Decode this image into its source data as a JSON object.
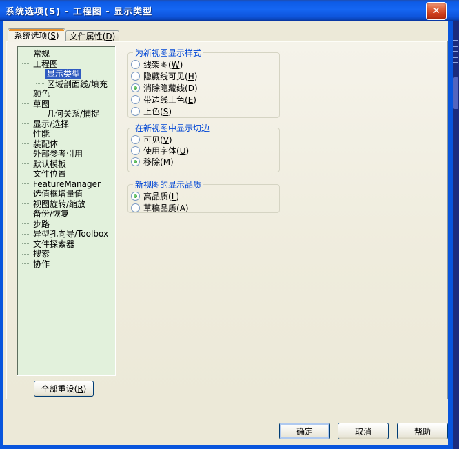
{
  "window": {
    "title": "系统选项(S) - 工程图 - 显示类型",
    "close_glyph": "✕"
  },
  "tabs": {
    "system_options": "系统选项(S)",
    "document_properties": "文件属性(D)"
  },
  "tree": {
    "items": [
      {
        "label": "常规",
        "level": 0
      },
      {
        "label": "工程图",
        "level": 0
      },
      {
        "label": "显示类型",
        "level": 1,
        "selected": true
      },
      {
        "label": "区域剖面线/填充",
        "level": 1
      },
      {
        "label": "颜色",
        "level": 0
      },
      {
        "label": "草图",
        "level": 0
      },
      {
        "label": "几何关系/捕捉",
        "level": 1
      },
      {
        "label": "显示/选择",
        "level": 0
      },
      {
        "label": "性能",
        "level": 0
      },
      {
        "label": "装配体",
        "level": 0
      },
      {
        "label": "外部参考引用",
        "level": 0
      },
      {
        "label": "默认模板",
        "level": 0
      },
      {
        "label": "文件位置",
        "level": 0
      },
      {
        "label": "FeatureManager",
        "level": 0
      },
      {
        "label": "选值框增量值",
        "level": 0
      },
      {
        "label": "视图旋转/缩放",
        "level": 0
      },
      {
        "label": "备份/恢复",
        "level": 0
      },
      {
        "label": "步路",
        "level": 0
      },
      {
        "label": "异型孔向导/Toolbox",
        "level": 0
      },
      {
        "label": "文件探索器",
        "level": 0
      },
      {
        "label": "搜索",
        "level": 0
      },
      {
        "label": "协作",
        "level": 0
      }
    ],
    "reset_button": "全部重设(R)"
  },
  "groups": [
    {
      "title": "为新视图显示样式",
      "options": [
        {
          "label": "线架图(W)",
          "checked": false
        },
        {
          "label": "隐藏线可见(H)",
          "checked": false
        },
        {
          "label": "消除隐藏线(D)",
          "checked": true
        },
        {
          "label": "带边线上色(E)",
          "checked": false
        },
        {
          "label": "上色(S)",
          "checked": false
        }
      ]
    },
    {
      "title": "在新视图中显示切边",
      "options": [
        {
          "label": "可见(V)",
          "checked": false
        },
        {
          "label": "使用字体(U)",
          "checked": false
        },
        {
          "label": "移除(M)",
          "checked": true
        }
      ]
    },
    {
      "title": "新视图的显示品质",
      "options": [
        {
          "label": "高品质(L)",
          "checked": true
        },
        {
          "label": "草稿品质(A)",
          "checked": false
        }
      ]
    }
  ],
  "footer": {
    "ok": "确定",
    "cancel": "取消",
    "help": "帮助"
  },
  "colors": {
    "titlebar_blue": "#1566F2",
    "window_border": "#0855DD",
    "dialog_bg": "#ECE9D8",
    "tree_bg": "#E2F1DC",
    "selection_bg": "#2F5BC0",
    "group_title_blue": "#0046D5",
    "active_tab_orange": "#E5912D",
    "radio_check_green": "#2E9A2E",
    "close_button_red": "#CC3C1B"
  }
}
